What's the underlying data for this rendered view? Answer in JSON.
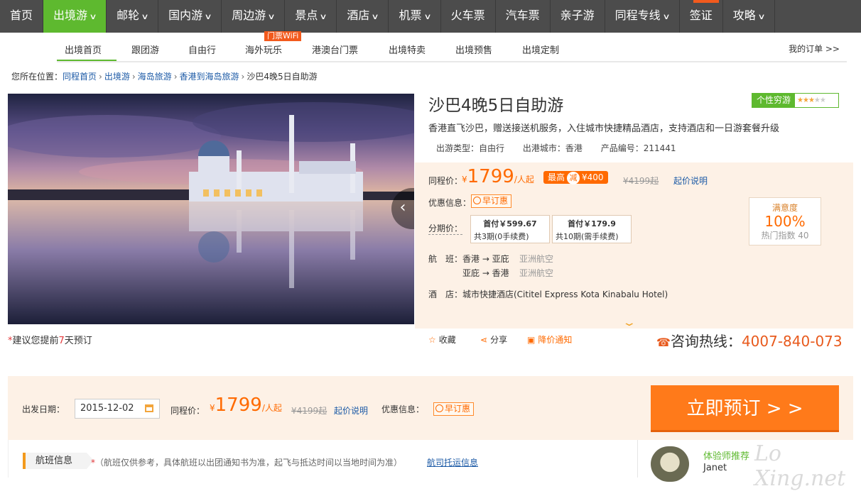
{
  "topnav": {
    "items": [
      {
        "label": "首页",
        "arrow": false
      },
      {
        "label": "出境游",
        "arrow": true
      },
      {
        "label": "邮轮",
        "arrow": true
      },
      {
        "label": "国内游",
        "arrow": true
      },
      {
        "label": "周边游",
        "arrow": true
      },
      {
        "label": "景点",
        "arrow": true
      },
      {
        "label": "酒店",
        "arrow": true
      },
      {
        "label": "机票",
        "arrow": true
      },
      {
        "label": "火车票",
        "arrow": false
      },
      {
        "label": "汽车票",
        "arrow": false
      },
      {
        "label": "亲子游",
        "arrow": false
      },
      {
        "label": "同程专线",
        "arrow": true
      },
      {
        "label": "签证",
        "arrow": false
      },
      {
        "label": "攻略",
        "arrow": true
      }
    ],
    "active_color": "#5eb92f"
  },
  "subnav": {
    "items": [
      "出境首页",
      "跟团游",
      "自由行",
      "海外玩乐",
      "港澳台门票",
      "出境特卖",
      "出境预售",
      "出境定制"
    ],
    "wifi_badge": "门票WiFi",
    "orders": "我的订单 >>"
  },
  "breadcrumb": {
    "prefix": "您所在位置：",
    "links": [
      "同程首页",
      "出境游",
      "海岛旅游",
      "香港到海岛旅游"
    ],
    "current": "沙巴4晚5日自助游"
  },
  "product": {
    "title": "沙巴4晚5日自助游",
    "tag": "个性穷游",
    "stars": 3,
    "subtitle": "香港直飞沙巴，赠送接送机服务，入住城市快捷精品酒店，支持酒店和一日游套餐升级",
    "type": "出游类型：自由行",
    "port": "出港城市：香港",
    "code": "产品编号：211441"
  },
  "pricing": {
    "label": "同程价：",
    "yen": "¥",
    "price": "1799",
    "unit": "/人起",
    "badge_prefix": "最高",
    "badge_circle": "减",
    "badge_amount": "¥400",
    "original": "¥4199起",
    "explain": "起价说明",
    "promo_label": "优惠信息：",
    "promo": "早订惠",
    "install_label": "分期价：",
    "installments": [
      {
        "first": "首付￥599.67",
        "plan": "共3期(0手续费)"
      },
      {
        "first": "首付￥179.9",
        "plan": "共10期(需手续费)"
      }
    ],
    "flight_label": "航　班：",
    "flights": [
      {
        "route": "香港 → 亚庇",
        "airline": "亚洲航空"
      },
      {
        "route": "亚庇 → 香港",
        "airline": "亚洲航空"
      }
    ],
    "hotel_label": "酒　店：",
    "hotel": "城市快捷酒店(Cititel Express Kota Kinabalu Hotel)",
    "satisfaction": {
      "title": "满意度",
      "value": "100%",
      "hot": "热门指数 40"
    }
  },
  "actions": {
    "favorite": "收藏",
    "share": "分享",
    "price_alert": "降价通知",
    "hotline_label": "咨询热线：",
    "hotline": "4007-840-073"
  },
  "advice": {
    "prefix": "建议您提前",
    "days": "7",
    "suffix": "天预订"
  },
  "booking": {
    "date_label": "出发日期：",
    "date": "2015-12-02",
    "price_label": "同程价：",
    "price": "1799",
    "unit": "/人起",
    "original": "¥4199起",
    "explain": "起价说明",
    "promo_label": "优惠信息：",
    "promo": "早订惠",
    "button": "立即预订 > >"
  },
  "flight_info": {
    "tab": "航班信息",
    "note_star": "*",
    "note": "（航班仅供参考，具体航班以出团通知书为准，起飞与抵达时间以当地时间为准）",
    "link": "航司托运信息"
  },
  "advisor": {
    "title": "体验师推荐",
    "name": "Janet"
  },
  "watermark": "Lo Xing.net"
}
